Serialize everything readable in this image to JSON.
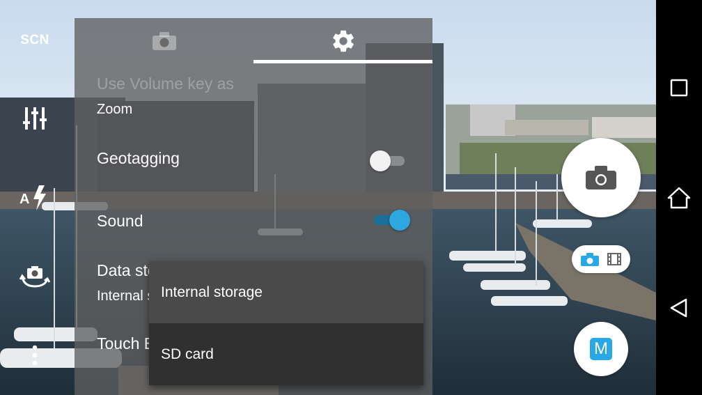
{
  "camera": {
    "scene_label": "SCN",
    "mode_badge_letter": "M"
  },
  "left_rail_icons": [
    "scene-icon",
    "manual-settings-icon",
    "auto-flash-icon",
    "switch-camera-icon",
    "more-options-icon"
  ],
  "settings_panel": {
    "tabs": [
      {
        "name": "camera-tab",
        "icon": "camera-icon",
        "active": false
      },
      {
        "name": "settings-tab",
        "icon": "gear-icon",
        "active": true
      }
    ],
    "rows": {
      "volume_key": "Use Volume key as",
      "volume_key_value": "Zoom",
      "geotagging": "Geotagging",
      "geotagging_on": false,
      "sound": "Sound",
      "sound_on": true,
      "data_storage": "Data storage",
      "data_storage_value": "Internal storage",
      "touch_block": "Touch Block"
    }
  },
  "storage_dropdown": {
    "options": [
      "Internal storage",
      "SD card"
    ]
  },
  "colors": {
    "toggle_on": "#2ea7e0",
    "mode_badge": "#29a8e8",
    "panel": "#5f5f5f",
    "dropdown": "#303030"
  },
  "nav_bar": [
    "recents-icon",
    "home-icon",
    "back-icon"
  ]
}
